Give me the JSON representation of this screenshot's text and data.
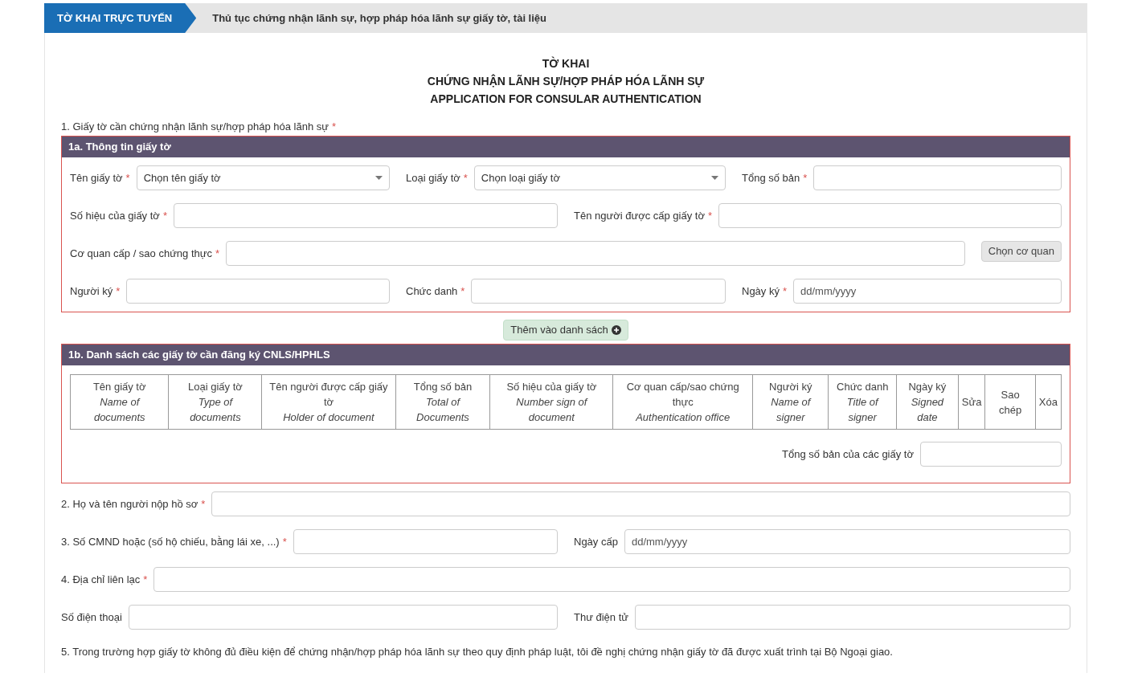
{
  "required_mark": "*",
  "header": {
    "tab": "TỜ KHAI TRỰC TUYẾN",
    "title": "Thủ tục chứng nhận lãnh sự, hợp pháp hóa lãnh sự giấy tờ, tài liệu"
  },
  "form_title": [
    "TỜ KHAI",
    "CHỨNG NHẬN LÃNH SỰ/HỢP PHÁP HÓA LÃNH SỰ",
    "APPLICATION FOR CONSULAR AUTHENTICATION"
  ],
  "section_1": {
    "label": "1. Giấy tờ cần chứng nhận lãnh sự/hợp pháp hóa lãnh sự",
    "required": true
  },
  "panel_1a": {
    "title": "1a. Thông tin giấy tờ",
    "rows": [
      [
        {
          "kind": "select",
          "label": "Tên giấy tờ",
          "required": true,
          "value": "Chọn tên giấy tờ"
        },
        {
          "kind": "select",
          "label": "Loại giấy tờ",
          "required": true,
          "value": "Chọn loại giấy tờ"
        },
        {
          "kind": "text",
          "label": "Tổng số bản",
          "required": true
        }
      ],
      [
        {
          "kind": "text",
          "label": "Số hiệu của giấy tờ",
          "required": true
        },
        {
          "kind": "text",
          "label": "Tên người được cấp giấy tờ",
          "required": true
        }
      ],
      [
        {
          "kind": "text",
          "label": "Cơ quan cấp / sao chứng thực",
          "required": true
        },
        {
          "kind": "button",
          "label": "Chọn cơ quan"
        }
      ],
      [
        {
          "kind": "text",
          "label": "Người ký",
          "required": true
        },
        {
          "kind": "text",
          "label": "Chức danh",
          "required": true
        },
        {
          "kind": "text",
          "label": "Ngày ký",
          "required": true,
          "placeholder": "dd/mm/yyyy"
        }
      ]
    ]
  },
  "add_button": "Thêm vào danh sách",
  "panel_1b": {
    "title": "1b. Danh sách các giấy tờ cần đăng ký CNLS/HPHLS",
    "columns": [
      {
        "title": "Tên giấy tờ",
        "subtitle": "Name of documents"
      },
      {
        "title": "Loại giấy tờ",
        "subtitle": "Type of documents"
      },
      {
        "title": "Tên người được cấp giấy tờ",
        "subtitle": "Holder of document"
      },
      {
        "title": "Tổng số bản",
        "subtitle": "Total of Documents"
      },
      {
        "title": "Số hiệu của giấy tờ",
        "subtitle": "Number sign of document"
      },
      {
        "title": "Cơ quan cấp/sao chứng thực",
        "subtitle": "Authentication office"
      },
      {
        "title": "Người ký",
        "subtitle": "Name of signer"
      },
      {
        "title": "Chức danh",
        "subtitle": "Title of signer"
      },
      {
        "title": "Ngày ký",
        "subtitle": "Signed date"
      },
      {
        "title": "Sửa"
      },
      {
        "title": "Sao chép"
      },
      {
        "title": "Xóa"
      }
    ],
    "total_label": "Tổng số bản của các giấy tờ"
  },
  "applicant_rows": [
    [
      {
        "kind": "text",
        "label": "2. Họ và tên người nộp hồ sơ",
        "required": true
      }
    ],
    [
      {
        "kind": "text",
        "label": "3. Số CMND hoặc (số hộ chiếu, bằng lái xe, ...)",
        "required": true
      },
      {
        "kind": "text",
        "label": "Ngày cấp",
        "required": false,
        "placeholder": "dd/mm/yyyy"
      }
    ],
    [
      {
        "kind": "text",
        "label": "4. Địa chỉ liên lạc",
        "required": true
      }
    ],
    [
      {
        "kind": "text",
        "label": "Số điện thoại",
        "required": false
      },
      {
        "kind": "text",
        "label": "Thư điện tử",
        "required": false
      }
    ]
  ],
  "note": "5. Trong trường hợp giấy tờ không đủ điều kiện để chứng nhận/hợp pháp hóa lãnh sự theo quy định pháp luật, tôi đề nghị chứng nhận giấy tờ đã được xuất trình tại Bộ Ngoại giao."
}
